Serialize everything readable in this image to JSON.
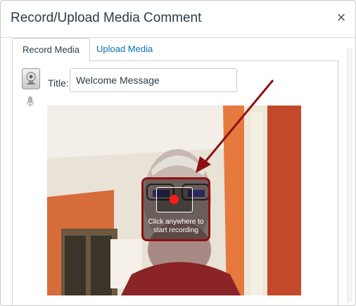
{
  "dialog": {
    "title": "Record/Upload Media Comment",
    "close_symbol": "×"
  },
  "tabs": [
    {
      "label": "Record Media",
      "active": true
    },
    {
      "label": "Upload Media",
      "active": false
    }
  ],
  "form": {
    "title_label": "Title:",
    "title_value": "Welcome Message"
  },
  "recorder": {
    "prompt_line1": "Click anywhere to",
    "prompt_line2": "start recording"
  },
  "icons": {
    "webcam": "webcam-icon",
    "microphone": "microphone-icon",
    "record": "record-dot-icon"
  },
  "colors": {
    "link": "#0a74b4",
    "record_dot": "#ff1b1b",
    "annotation": "#8f1014"
  }
}
